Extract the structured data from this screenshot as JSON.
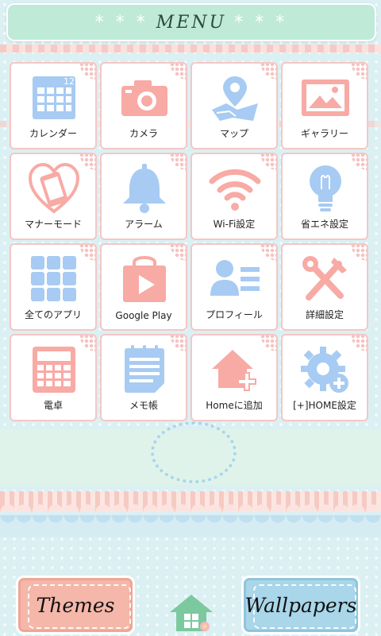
{
  "header": {
    "title": "MENU",
    "left_decoration": "* * *",
    "right_decoration": "* * *"
  },
  "tiles": [
    {
      "label": "カレンダー",
      "icon": "calendar-icon",
      "calendar_day": "12"
    },
    {
      "label": "カメラ",
      "icon": "camera-icon"
    },
    {
      "label": "マップ",
      "icon": "map-icon"
    },
    {
      "label": "ギャラリー",
      "icon": "gallery-icon"
    },
    {
      "label": "マナーモード",
      "icon": "manner-mode-icon"
    },
    {
      "label": "アラーム",
      "icon": "alarm-bell-icon"
    },
    {
      "label": "Wi-Fi設定",
      "icon": "wifi-icon"
    },
    {
      "label": "省エネ設定",
      "icon": "lightbulb-icon"
    },
    {
      "label": "全てのアプリ",
      "icon": "all-apps-grid-icon"
    },
    {
      "label": "Google Play",
      "icon": "google-play-icon"
    },
    {
      "label": "プロフィール",
      "icon": "profile-icon"
    },
    {
      "label": "詳細設定",
      "icon": "tools-icon"
    },
    {
      "label": "電卓",
      "icon": "calculator-icon"
    },
    {
      "label": "メモ帳",
      "icon": "memo-pad-icon"
    },
    {
      "label": "Homeに追加",
      "icon": "add-home-icon"
    },
    {
      "label": "[+]HOME設定",
      "icon": "home-settings-gear-icon"
    }
  ],
  "buttons": {
    "themes": "Themes",
    "wallpapers": "Wallpapers"
  },
  "colors": {
    "pink": "#f8aaa5",
    "blue": "#a7cbf2",
    "mint": "#bfead8"
  }
}
